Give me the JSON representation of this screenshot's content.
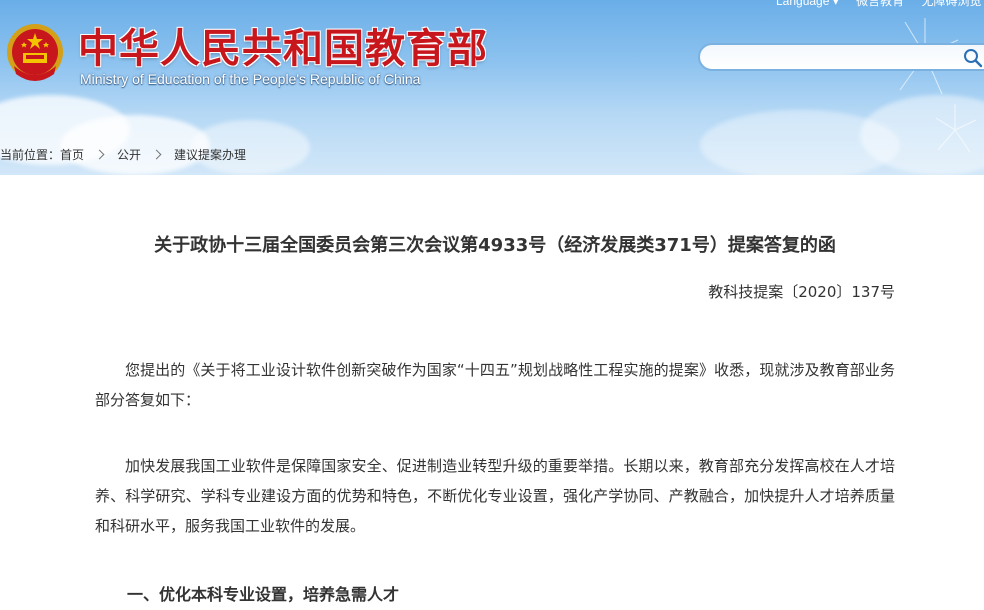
{
  "header": {
    "title_cn": "中华人民共和国教育部",
    "title_en": "Ministry of Education of the People's Republic of China",
    "top_links": [
      "Language ▾",
      "微言教育",
      "无障碍浏览"
    ]
  },
  "search": {
    "value": "",
    "placeholder": ""
  },
  "breadcrumb": {
    "label": "当前位置：",
    "items": [
      "首页",
      "公开",
      "建议提案办理"
    ]
  },
  "article": {
    "title": "关于政协十三届全国委员会第三次会议第4933号（经济发展类371号）提案答复的函",
    "doc_number": "教科技提案〔2020〕137号",
    "paragraphs": [
      "您提出的《关于将工业设计软件创新突破作为国家“十四五”规划战略性工程实施的提案》收悉，现就涉及教育部业务部分答复如下：",
      "加快发展我国工业软件是保障国家安全、促进制造业转型升级的重要举措。长期以来，教育部充分发挥高校在人才培养、科学研究、学科专业建设方面的优势和特色，不断优化专业设置，强化产学协同、产教融合，加快提升人才培养质量和科研水平，服务我国工业软件的发展。"
    ],
    "section_heading": "一、优化本科专业设置，培养急需人才"
  },
  "colors": {
    "title_red": "#c8161d",
    "sky_blue": "#8cc2ef",
    "text": "#333333"
  }
}
